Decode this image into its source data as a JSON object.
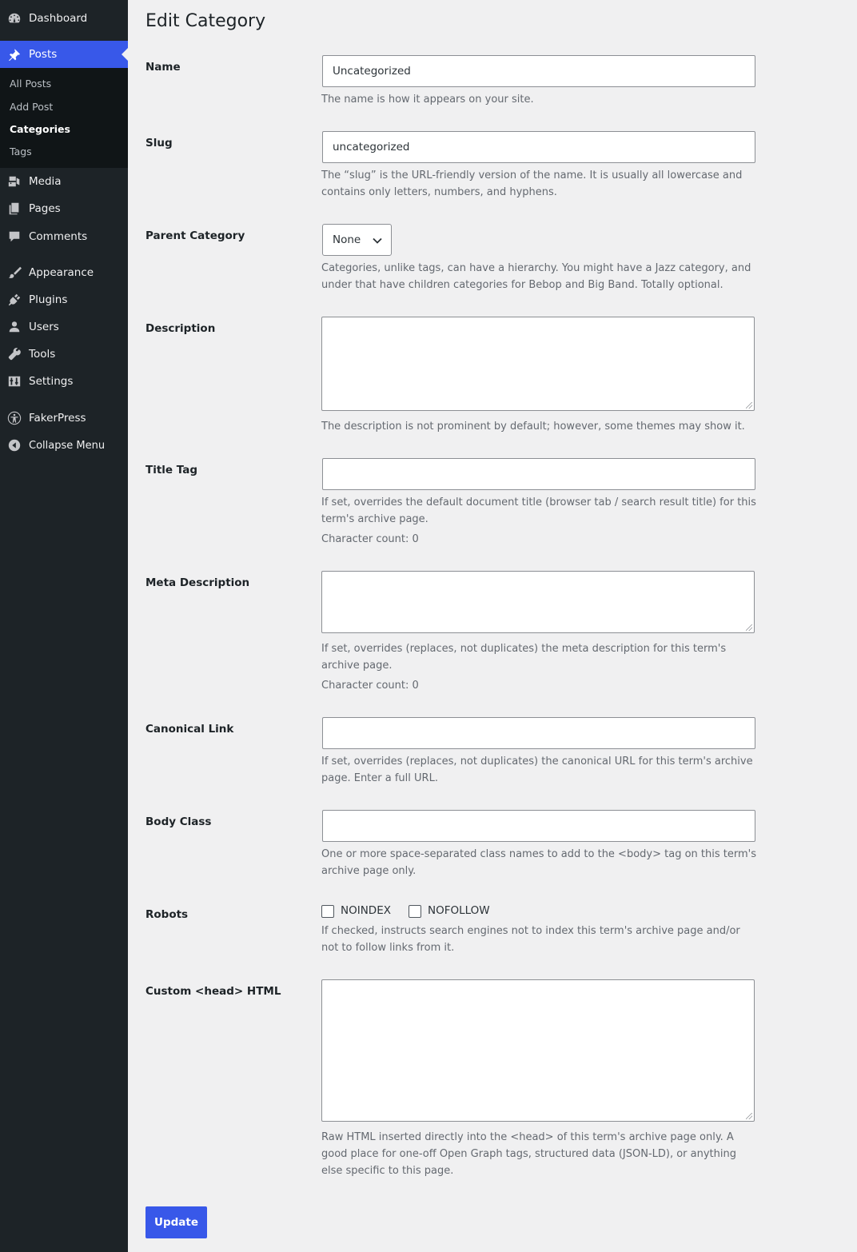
{
  "sidebar": {
    "menu": {
      "dashboard": "Dashboard",
      "posts": "Posts",
      "media": "Media",
      "pages": "Pages",
      "comments": "Comments",
      "appearance": "Appearance",
      "plugins": "Plugins",
      "users": "Users",
      "tools": "Tools",
      "settings": "Settings",
      "fakerpress": "FakerPress",
      "collapse": "Collapse Menu"
    },
    "submenu": {
      "all_posts": "All Posts",
      "add_post": "Add Post",
      "categories": "Categories",
      "tags": "Tags"
    },
    "accent_color": "#3858e9"
  },
  "page": {
    "title": "Edit Category"
  },
  "form": {
    "name": {
      "label": "Name",
      "value": "Uncategorized",
      "help": "The name is how it appears on your site."
    },
    "slug": {
      "label": "Slug",
      "value": "uncategorized",
      "help": "The “slug” is the URL-friendly version of the name. It is usually all lowercase and contains only letters, numbers, and hyphens."
    },
    "parent": {
      "label": "Parent Category",
      "selected": "None",
      "help": "Categories, unlike tags, can have a hierarchy. You might have a Jazz category, and under that have children categories for Bebop and Big Band. Totally optional."
    },
    "description": {
      "label": "Description",
      "value": "",
      "help": "The description is not prominent by default; however, some themes may show it."
    },
    "title_tag": {
      "label": "Title Tag",
      "value": "",
      "help": "If set, overrides the default document title (browser tab / search result title) for this term's archive page.",
      "count": "Character count: 0"
    },
    "meta_description": {
      "label": "Meta Description",
      "value": "",
      "help": "If set, overrides (replaces, not duplicates) the meta description for this term's archive page.",
      "count": "Character count: 0"
    },
    "canonical": {
      "label": "Canonical Link",
      "value": "",
      "help": "If set, overrides (replaces, not duplicates) the canonical URL for this term's archive page. Enter a full URL."
    },
    "body_class": {
      "label": "Body Class",
      "value": "",
      "help": "One or more space-separated class names to add to the <body> tag on this term's archive page only."
    },
    "robots": {
      "label": "Robots",
      "noindex": "NOINDEX",
      "nofollow": "NOFOLLOW",
      "noindex_checked": false,
      "nofollow_checked": false,
      "help": "If checked, instructs search engines not to index this term's archive page and/or not to follow links from it."
    },
    "custom_head": {
      "label": "Custom <head> HTML",
      "value": "",
      "help": "Raw HTML inserted directly into the <head> of this term's archive page only. A good place for one-off Open Graph tags, structured data (JSON-LD), or anything else specific to this page."
    },
    "update_label": "Update"
  }
}
